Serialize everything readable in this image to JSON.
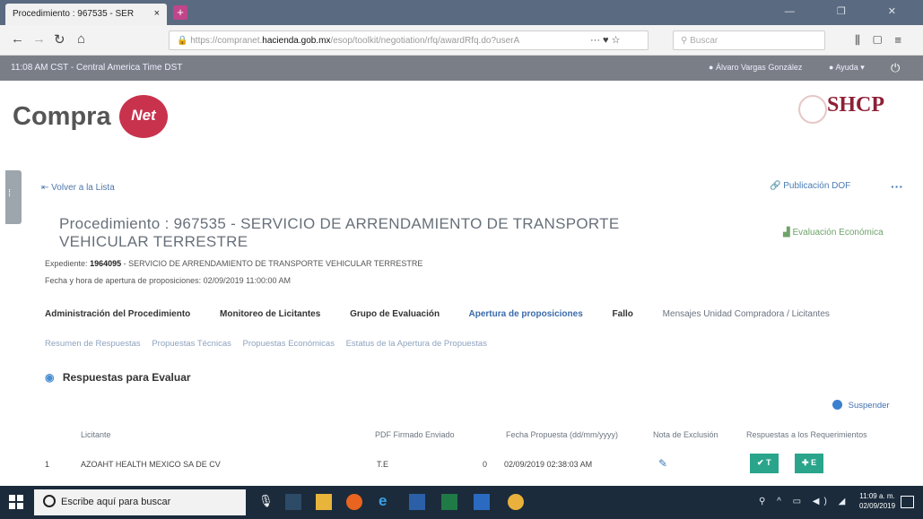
{
  "browser": {
    "tab_title": "Procedimiento : 967535 - SER",
    "tab_close": "×",
    "new_tab": "+",
    "url_prefix": "https://compranet.",
    "url_domain": "hacienda.gob.mx",
    "url_suffix": "/esop/toolkit/negotiation/rfq/awardRfq.do?userA",
    "url_extras": "··· ♥ ☆",
    "search_placeholder": "Buscar",
    "win_controls": "— ❐ ✕"
  },
  "appbar": {
    "time": "11:08 AM CST - Central America Time DST",
    "user": "Álvaro Vargas González",
    "help": "Ayuda ▾"
  },
  "header": {
    "logo_compra": "Compra",
    "logo_net": "Net",
    "shcp": "SHCP"
  },
  "main": {
    "back": "Volver a la Lista",
    "publicacion": "Publicación DOF",
    "more": "···",
    "title": "Procedimiento : 967535 - SERVICIO DE ARRENDAMIENTO DE TRANSPORTE VEHICULAR TERRESTRE",
    "evaluacion": "Evaluación Económica",
    "exp_label": "Expediente:",
    "exp_number": "1964095",
    "exp_desc": "- SERVICIO DE ARRENDAMIENTO DE TRANSPORTE VEHICULAR TERRESTRE",
    "fecha": "Fecha y hora de apertura de proposiciones: 02/09/2019 11:00:00 AM",
    "tabs": [
      "Administración del Procedimiento",
      "Monitoreo de Licitantes",
      "Grupo de Evaluación",
      "Apertura de proposiciones",
      "Fallo",
      "Mensajes Unidad Compradora / Licitantes"
    ],
    "subtabs": [
      "Resumen de Respuestas",
      "Propuestas Técnicas",
      "Propuestas Económicas",
      "Estatus de la Apertura de Propuestas"
    ],
    "responses_title": "Respuestas para Evaluar",
    "suspend": "Suspender"
  },
  "table": {
    "headers": [
      "Licitante",
      "PDF Firmado Enviado",
      "Fecha Propuesta (dd/mm/yyyy)",
      "Nota de Exclusión",
      "Respuestas a los Requerimientos"
    ],
    "rows": [
      {
        "num": "1",
        "name": "AZOAHT HEALTH MEXICO SA DE CV",
        "pdf": "T.E",
        "zero": "0",
        "date": "02/09/2019 02:38:03 AM",
        "btn_t": "T",
        "btn_e": "E"
      }
    ]
  },
  "taskbar": {
    "search": "Escribe aquí para buscar",
    "time": "11:09 a. m.",
    "date": "02/09/2019"
  }
}
